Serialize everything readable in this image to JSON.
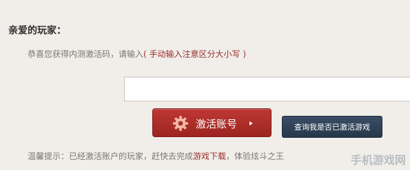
{
  "greeting": "亲爱的玩家：",
  "intro": {
    "text": "恭喜您获得内测激活码，请输入",
    "hint": "( 手动输入注意区分大小写 )"
  },
  "code_input": {
    "value": "",
    "placeholder": ""
  },
  "activate_button": {
    "label": "激活账号",
    "icon": "gear-icon"
  },
  "query_button": {
    "label": "查询我是否已激活游戏"
  },
  "tip": {
    "prefix": "温馨提示：已经激活账户的玩家，赶快去完成",
    "link": "游戏下载",
    "suffix": "，体验炫斗之王"
  },
  "watermark": "手机游戏网",
  "colors": {
    "background": "#f1eeea",
    "accent_red": "#9b2f2b",
    "button_red": "#b0302c",
    "button_navy": "#2f4259"
  }
}
